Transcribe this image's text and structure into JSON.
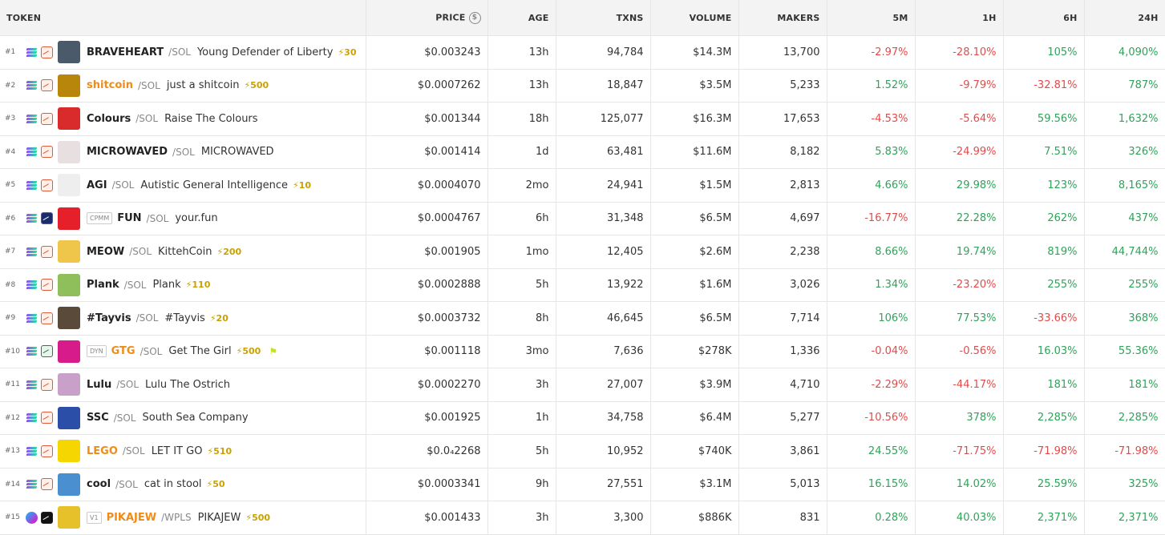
{
  "headers": {
    "token": "TOKEN",
    "price": "PRICE",
    "age": "AGE",
    "txns": "TXNS",
    "volume": "VOLUME",
    "makers": "MAKERS",
    "m5": "5M",
    "h1": "1H",
    "h6": "6H",
    "h24": "24H"
  },
  "icons": {
    "price_currency": "dollar-icon",
    "boost": "bolt-icon",
    "chain_sol": "solana-icon"
  },
  "rows": [
    {
      "rank": "#1",
      "chain": "sol",
      "dex": "meteora",
      "badge": "",
      "symbol": "BRAVEHEART",
      "quote": "/SOL",
      "name": "Young Defender of Liberty",
      "boost": "⚡30",
      "flag": "",
      "orange": false,
      "avatar_color": "#4a5a6b",
      "price": "$0.003243",
      "age": "13h",
      "txns": "94,784",
      "volume": "$14.3M",
      "makers": "13,700",
      "m5": "-2.97%",
      "h1": "-28.10%",
      "h6": "105%",
      "h24": "4,090%"
    },
    {
      "rank": "#2",
      "chain": "sol",
      "dex": "meteora",
      "badge": "",
      "symbol": "shitcoin",
      "quote": "/SOL",
      "name": "just a shitcoin",
      "boost": "⚡500",
      "flag": "",
      "orange": true,
      "avatar_color": "#b8860b",
      "price": "$0.0007262",
      "age": "13h",
      "txns": "18,847",
      "volume": "$3.5M",
      "makers": "5,233",
      "m5": "1.52%",
      "h1": "-9.79%",
      "h6": "-32.81%",
      "h24": "787%"
    },
    {
      "rank": "#3",
      "chain": "sol",
      "dex": "meteora",
      "badge": "",
      "symbol": "Colours",
      "quote": "/SOL",
      "name": "Raise The Colours",
      "boost": "",
      "flag": "",
      "orange": false,
      "avatar_color": "#d92b2b",
      "price": "$0.001344",
      "age": "18h",
      "txns": "125,077",
      "volume": "$16.3M",
      "makers": "17,653",
      "m5": "-4.53%",
      "h1": "-5.64%",
      "h6": "59.56%",
      "h24": "1,632%"
    },
    {
      "rank": "#4",
      "chain": "sol",
      "dex": "meteora",
      "badge": "",
      "symbol": "MICROWAVED",
      "quote": "/SOL",
      "name": "MICROWAVED",
      "boost": "",
      "flag": "",
      "orange": false,
      "avatar_color": "#e8e0e0",
      "price": "$0.001414",
      "age": "1d",
      "txns": "63,481",
      "volume": "$11.6M",
      "makers": "8,182",
      "m5": "5.83%",
      "h1": "-24.99%",
      "h6": "7.51%",
      "h24": "326%"
    },
    {
      "rank": "#5",
      "chain": "sol",
      "dex": "meteora",
      "badge": "",
      "symbol": "AGI",
      "quote": "/SOL",
      "name": "Autistic General Intelligence",
      "boost": "⚡10",
      "flag": "",
      "orange": false,
      "avatar_color": "#eeeeee",
      "price": "$0.0004070",
      "age": "2mo",
      "txns": "24,941",
      "volume": "$1.5M",
      "makers": "2,813",
      "m5": "4.66%",
      "h1": "29.98%",
      "h6": "123%",
      "h24": "8,165%"
    },
    {
      "rank": "#6",
      "chain": "sol",
      "dex": "raydium",
      "badge": "CPMM",
      "symbol": "FUN",
      "quote": "/SOL",
      "name": "your.fun",
      "boost": "",
      "flag": "",
      "orange": false,
      "avatar_color": "#e5202b",
      "price": "$0.0004767",
      "age": "6h",
      "txns": "31,348",
      "volume": "$6.5M",
      "makers": "4,697",
      "m5": "-16.77%",
      "h1": "22.28%",
      "h6": "262%",
      "h24": "437%"
    },
    {
      "rank": "#7",
      "chain": "sol",
      "dex": "meteora",
      "badge": "",
      "symbol": "MEOW",
      "quote": "/SOL",
      "name": "KittehCoin",
      "boost": "⚡200",
      "flag": "",
      "orange": false,
      "avatar_color": "#f0c64a",
      "price": "$0.001905",
      "age": "1mo",
      "txns": "12,405",
      "volume": "$2.6M",
      "makers": "2,238",
      "m5": "8.66%",
      "h1": "19.74%",
      "h6": "819%",
      "h24": "44,744%"
    },
    {
      "rank": "#8",
      "chain": "sol",
      "dex": "meteora",
      "badge": "",
      "symbol": "Plank",
      "quote": "/SOL",
      "name": "Plank",
      "boost": "⚡110",
      "flag": "",
      "orange": false,
      "avatar_color": "#8fbf5a",
      "price": "$0.0002888",
      "age": "5h",
      "txns": "13,922",
      "volume": "$1.6M",
      "makers": "3,026",
      "m5": "1.34%",
      "h1": "-23.20%",
      "h6": "255%",
      "h24": "255%"
    },
    {
      "rank": "#9",
      "chain": "sol",
      "dex": "meteora",
      "badge": "",
      "symbol": "#Tayvis",
      "quote": "/SOL",
      "name": "#Tayvis",
      "boost": "⚡20",
      "flag": "",
      "orange": false,
      "avatar_color": "#5a4a3a",
      "price": "$0.0003732",
      "age": "8h",
      "txns": "46,645",
      "volume": "$6.5M",
      "makers": "7,714",
      "m5": "106%",
      "h1": "77.53%",
      "h6": "-33.66%",
      "h24": "368%"
    },
    {
      "rank": "#10",
      "chain": "sol",
      "dex": "orca",
      "badge": "DYN",
      "symbol": "GTG",
      "quote": "/SOL",
      "name": "Get The Girl",
      "boost": "⚡500",
      "flag": "⚑",
      "orange": true,
      "avatar_color": "#d81b8a",
      "price": "$0.001118",
      "age": "3mo",
      "txns": "7,636",
      "volume": "$278K",
      "makers": "1,336",
      "m5": "-0.04%",
      "h1": "-0.56%",
      "h6": "16.03%",
      "h24": "55.36%"
    },
    {
      "rank": "#11",
      "chain": "sol",
      "dex": "meteora",
      "badge": "",
      "symbol": "Lulu",
      "quote": "/SOL",
      "name": "Lulu The Ostrich",
      "boost": "",
      "flag": "",
      "orange": false,
      "avatar_color": "#c8a0c8",
      "price": "$0.0002270",
      "age": "3h",
      "txns": "27,007",
      "volume": "$3.9M",
      "makers": "4,710",
      "m5": "-2.29%",
      "h1": "-44.17%",
      "h6": "181%",
      "h24": "181%"
    },
    {
      "rank": "#12",
      "chain": "sol",
      "dex": "meteora",
      "badge": "",
      "symbol": "SSC",
      "quote": "/SOL",
      "name": "South Sea Company",
      "boost": "",
      "flag": "",
      "orange": false,
      "avatar_color": "#2b4fa8",
      "price": "$0.001925",
      "age": "1h",
      "txns": "34,758",
      "volume": "$6.4M",
      "makers": "5,277",
      "m5": "-10.56%",
      "h1": "378%",
      "h6": "2,285%",
      "h24": "2,285%"
    },
    {
      "rank": "#13",
      "chain": "sol",
      "dex": "meteora",
      "badge": "",
      "symbol": "LEGO",
      "quote": "/SOL",
      "name": "LET IT GO",
      "boost": "⚡510",
      "flag": "",
      "orange": true,
      "avatar_color": "#f5d600",
      "price": "$0.0₄2268",
      "age": "5h",
      "txns": "10,952",
      "volume": "$740K",
      "makers": "3,861",
      "m5": "24.55%",
      "h1": "-71.75%",
      "h6": "-71.98%",
      "h24": "-71.98%"
    },
    {
      "rank": "#14",
      "chain": "sol",
      "dex": "meteora",
      "badge": "",
      "symbol": "cool",
      "quote": "/SOL",
      "name": "cat in stool",
      "boost": "⚡50",
      "flag": "",
      "orange": false,
      "avatar_color": "#4a8fd0",
      "price": "$0.0003341",
      "age": "9h",
      "txns": "27,551",
      "volume": "$3.1M",
      "makers": "5,013",
      "m5": "16.15%",
      "h1": "14.02%",
      "h6": "25.59%",
      "h24": "325%"
    },
    {
      "rank": "#15",
      "chain": "pls",
      "dex": "pulsex",
      "badge": "V1",
      "symbol": "PIKAJEW",
      "quote": "/WPLS",
      "name": "PIKAJEW",
      "boost": "⚡500",
      "flag": "",
      "orange": true,
      "avatar_color": "#e6c12a",
      "price": "$0.001433",
      "age": "3h",
      "txns": "3,300",
      "volume": "$886K",
      "makers": "831",
      "m5": "0.28%",
      "h1": "40.03%",
      "h6": "2,371%",
      "h24": "2,371%"
    }
  ]
}
